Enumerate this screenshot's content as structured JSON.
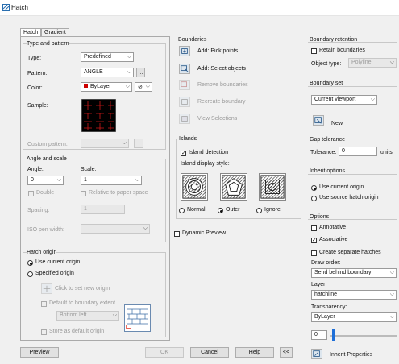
{
  "window": {
    "title": "Hatch"
  },
  "tabs": [
    "Hatch",
    "Gradient"
  ],
  "type_pattern": {
    "group_label": "Type and pattern",
    "type_label": "Type:",
    "type_value": "Predefined",
    "pattern_label": "Pattern:",
    "pattern_value": "ANGLE",
    "pattern_btn": "...",
    "color_label": "Color:",
    "color_value": "ByLayer",
    "color_swatch": "#cc0000",
    "sample_label": "Sample:",
    "custom_label": "Custom pattern:"
  },
  "angle_scale": {
    "group_label": "Angle and scale",
    "angle_label": "Angle:",
    "angle_value": "0",
    "scale_label": "Scale:",
    "scale_value": "1",
    "double_label": "Double",
    "relative_label": "Relative to paper space",
    "spacing_label": "Spacing:",
    "spacing_value": "1",
    "iso_label": "ISO pen width:"
  },
  "origin": {
    "group_label": "Hatch origin",
    "use_current": "Use current origin",
    "specified": "Specified origin",
    "click_set": "Click to set new origin",
    "default_extent": "Default to boundary extent",
    "extent_value": "Bottom left",
    "store_default": "Store as default origin"
  },
  "boundaries": {
    "group_label": "Boundaries",
    "add_pick": "Add: Pick points",
    "add_select": "Add: Select objects",
    "remove": "Remove boundaries",
    "recreate": "Recreate boundary",
    "view": "View Selections"
  },
  "islands": {
    "group_label": "Islands",
    "detection": "Island detection",
    "display_label": "Island display style:",
    "normal": "Normal",
    "outer": "Outer",
    "ignore": "Ignore"
  },
  "dynamic_preview": "Dynamic Preview",
  "retention": {
    "group_label": "Boundary retention",
    "retain": "Retain boundaries",
    "object_type_label": "Object type:",
    "object_type_value": "Polyline"
  },
  "boundary_set": {
    "group_label": "Boundary set",
    "value": "Current viewport",
    "new_label": "New"
  },
  "gap": {
    "group_label": "Gap tolerance",
    "tol_label": "Tolerance:",
    "tol_value": "0",
    "units": "units"
  },
  "inherit_opts": {
    "group_label": "Inherit options",
    "use_current": "Use current origin",
    "use_source": "Use source hatch origin"
  },
  "options": {
    "group_label": "Options",
    "annotative": "Annotative",
    "associative": "Associative",
    "separate": "Create separate hatches",
    "draw_order_label": "Draw order:",
    "draw_order_value": "Send behind boundary",
    "layer_label": "Layer:",
    "layer_value": "hatchline",
    "transparency_label": "Transparency:",
    "transparency_value": "ByLayer",
    "transparency_num": "0"
  },
  "inherit_props": "Inherit Properties",
  "buttons": {
    "preview": "Preview",
    "ok": "OK",
    "cancel": "Cancel",
    "help": "Help",
    "collapse": "<<"
  }
}
